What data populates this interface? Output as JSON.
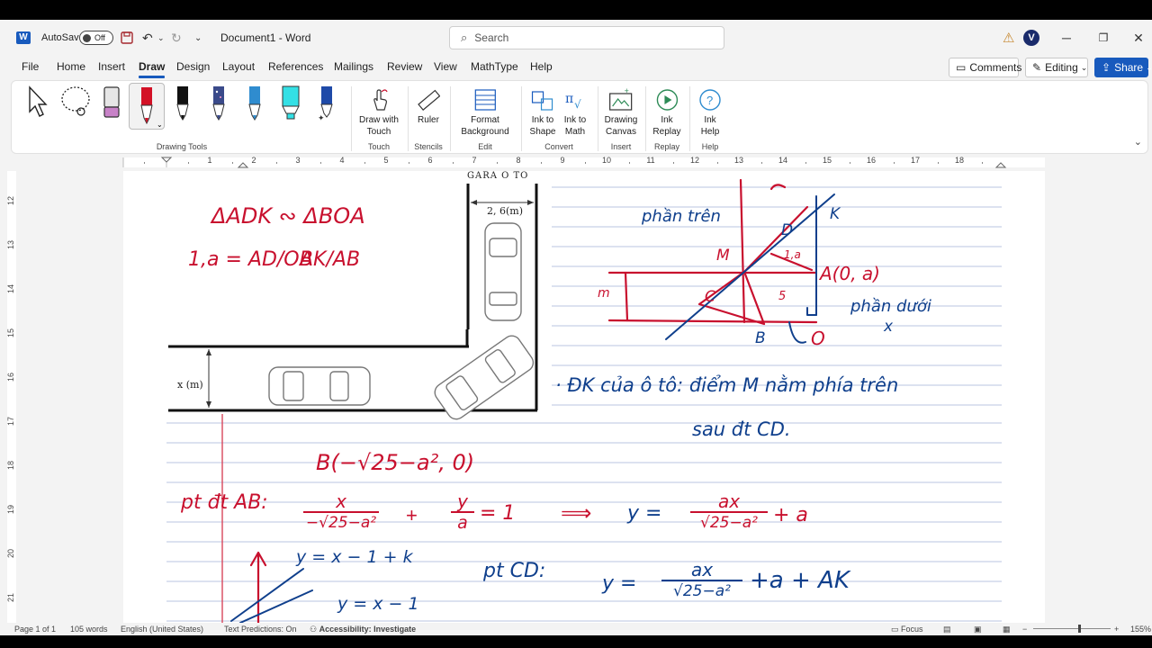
{
  "titlebar": {
    "autosave_label": "AutoSave",
    "toggle_state": "Off",
    "doc_title": "Document1  -  Word",
    "search_placeholder": "Search"
  },
  "menu": {
    "items": [
      "File",
      "Home",
      "Insert",
      "Draw",
      "Design",
      "Layout",
      "References",
      "Mailings",
      "Review",
      "View",
      "MathType",
      "Help"
    ],
    "active": "Draw",
    "comments": "Comments",
    "editing": "Editing",
    "share": "Share"
  },
  "ribbon": {
    "groups": {
      "drawing_tools": "Drawing Tools",
      "touch": "Touch",
      "stencils": "Stencils",
      "edit": "Edit",
      "convert": "Convert",
      "insert": "Insert",
      "replay": "Replay",
      "help": "Help"
    },
    "commands": {
      "draw_with_touch": "Draw with\nTouch",
      "ruler": "Ruler",
      "format_background": "Format\nBackground",
      "ink_to_shape": "Ink to\nShape",
      "ink_to_math": "Ink to\nMath",
      "drawing_canvas": "Drawing\nCanvas",
      "ink_replay": "Ink\nReplay",
      "ink_help": "Ink\nHelp"
    }
  },
  "ruler": {
    "numbers": [
      "1",
      "2",
      "3",
      "4",
      "5",
      "6",
      "7",
      "8",
      "9",
      "10",
      "11",
      "12",
      "13",
      "14",
      "15",
      "16",
      "17",
      "18"
    ],
    "vnumbers": [
      "12",
      "13",
      "14",
      "15",
      "16",
      "17",
      "18",
      "19",
      "20",
      "21"
    ]
  },
  "page": {
    "figure": {
      "garage_label": "GARA Ô TÔ",
      "width_label": "2, 6(m)",
      "x_label": "x (m)"
    },
    "ink": {
      "similar": "ΔADK ∾ ΔBOA",
      "ratio_left": "1,a = AD/OB",
      "ratio_right": "AK/AB",
      "upper_part": "phần trên",
      "lower_part": "phần dưới",
      "point_M": "M",
      "point_D": "D",
      "point_K": "K",
      "point_A": "A(0, a)",
      "point_C": "C",
      "point_B": "B",
      "point_O": "O",
      "point_x": "x",
      "label_m": "m",
      "label_1a": "1,a",
      "label_5": "5",
      "condition_line1": "· ĐK của ô tô:  điểm  M nằm phía trên",
      "condition_line2": "sau đt CD.",
      "point_B_coord": "B(−√25−a², 0)",
      "line_AB": "pt đt AB:",
      "eq_ab_frac1_num": "x",
      "eq_ab_frac1_den": "−√25−a²",
      "eq_ab_plus": "+",
      "eq_ab_frac2_num": "y",
      "eq_ab_frac2_den": "a",
      "eq_ab_rhs": "= 1",
      "implies": "⟹",
      "eq_y": "y =",
      "eq_y_num": "ax",
      "eq_y_den": "√25−a²",
      "eq_y_tail": "+ a",
      "line_CD": "pt CD:",
      "eq_cd_y": "y =",
      "eq_cd_num": "ax",
      "eq_cd_den": "√25−a²",
      "eq_cd_tail": "+a + AK",
      "graph_eq1": "y = x − 1 + k",
      "graph_eq2": "y = x − 1"
    }
  },
  "status": {
    "page": "Page 1 of 1",
    "words": "105 words",
    "language": "English (United States)",
    "predictions": "Text Predictions: On",
    "accessibility": "Accessibility: Investigate",
    "focus": "Focus",
    "zoom": "155%"
  }
}
